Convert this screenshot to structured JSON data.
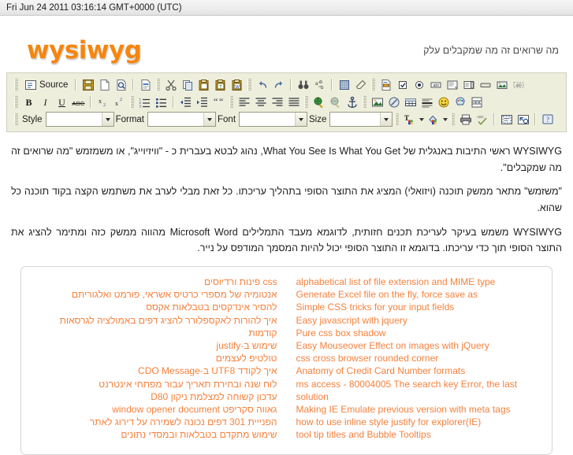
{
  "statusbar": {
    "datetime": "Fri Jun 24 2011 03:16:14 GMT+0000 (UTC)"
  },
  "header": {
    "logo": "wysiwyg",
    "tagline": "מה שרואים זה מה שמקבלים עלק"
  },
  "editor": {
    "toolbar_rows": [
      {
        "id": "row1",
        "items": [
          {
            "type": "grip",
            "name": "toolbar-grip"
          },
          {
            "type": "source",
            "name": "source-button",
            "label": "Source",
            "icon": "source-icon"
          },
          {
            "type": "sep"
          },
          {
            "type": "btn",
            "name": "save-button",
            "icon": "floppy-save-icon"
          },
          {
            "type": "btn",
            "name": "new-page-button",
            "icon": "new-page-icon"
          },
          {
            "type": "btn",
            "name": "preview-button",
            "icon": "preview-magnifier-icon"
          },
          {
            "type": "sep"
          },
          {
            "type": "btn",
            "name": "templates-button",
            "icon": "templates-icon"
          },
          {
            "type": "grip",
            "name": "toolbar-grip"
          },
          {
            "type": "btn",
            "name": "cut-button",
            "icon": "scissors-icon"
          },
          {
            "type": "btn",
            "name": "copy-button",
            "icon": "copy-icon"
          },
          {
            "type": "btn",
            "name": "paste-button",
            "icon": "paste-icon"
          },
          {
            "type": "btn",
            "name": "paste-text-button",
            "icon": "paste-text-icon"
          },
          {
            "type": "btn",
            "name": "paste-word-button",
            "icon": "paste-word-icon"
          },
          {
            "type": "grip",
            "name": "toolbar-grip"
          },
          {
            "type": "btn",
            "name": "undo-button",
            "icon": "undo-arrow-icon"
          },
          {
            "type": "btn",
            "name": "redo-button",
            "icon": "redo-arrow-icon"
          },
          {
            "type": "sep"
          },
          {
            "type": "btn",
            "name": "find-button",
            "icon": "binoculars-icon"
          },
          {
            "type": "btn",
            "name": "replace-button",
            "icon": "replace-icon"
          },
          {
            "type": "sep"
          },
          {
            "type": "btn",
            "name": "select-all-button",
            "icon": "select-all-icon"
          },
          {
            "type": "btn",
            "name": "remove-format-button",
            "icon": "eraser-icon"
          },
          {
            "type": "grip",
            "name": "toolbar-grip"
          },
          {
            "type": "btn",
            "name": "form-button",
            "icon": "form-icon"
          },
          {
            "type": "btn",
            "name": "checkbox-button",
            "icon": "checkbox-icon"
          },
          {
            "type": "btn",
            "name": "radio-button",
            "icon": "radio-icon"
          },
          {
            "type": "btn",
            "name": "text-field-button",
            "icon": "text-field-icon"
          },
          {
            "type": "btn",
            "name": "textarea-button",
            "icon": "textarea-icon"
          },
          {
            "type": "btn",
            "name": "select-field-button",
            "icon": "select-field-icon"
          },
          {
            "type": "btn",
            "name": "push-button-button",
            "icon": "push-button-icon"
          },
          {
            "type": "btn",
            "name": "image-button-button",
            "icon": "image-button-icon"
          },
          {
            "type": "btn",
            "name": "hidden-field-button",
            "icon": "hidden-field-icon"
          }
        ]
      },
      {
        "id": "row2",
        "items": [
          {
            "type": "grip",
            "name": "toolbar-grip"
          },
          {
            "type": "btn",
            "name": "bold-button",
            "icon": "bold-icon",
            "text": "B"
          },
          {
            "type": "btn",
            "name": "italic-button",
            "icon": "italic-icon",
            "text": "I"
          },
          {
            "type": "btn",
            "name": "underline-button",
            "icon": "underline-icon",
            "text": "U"
          },
          {
            "type": "btn",
            "name": "strikethrough-button",
            "icon": "strikethrough-icon",
            "text": "ABC"
          },
          {
            "type": "sep"
          },
          {
            "type": "btn",
            "name": "subscript-button",
            "icon": "subscript-icon"
          },
          {
            "type": "btn",
            "name": "superscript-button",
            "icon": "superscript-icon"
          },
          {
            "type": "grip",
            "name": "toolbar-grip"
          },
          {
            "type": "btn",
            "name": "numbered-list-button",
            "icon": "numbered-list-icon"
          },
          {
            "type": "btn",
            "name": "bulleted-list-button",
            "icon": "bulleted-list-icon"
          },
          {
            "type": "sep"
          },
          {
            "type": "btn",
            "name": "decrease-indent-button",
            "icon": "outdent-icon"
          },
          {
            "type": "btn",
            "name": "increase-indent-button",
            "icon": "indent-icon"
          },
          {
            "type": "btn",
            "name": "blockquote-button",
            "icon": "blockquote-icon"
          },
          {
            "type": "grip",
            "name": "toolbar-grip"
          },
          {
            "type": "btn",
            "name": "align-left-button",
            "icon": "align-left-icon"
          },
          {
            "type": "btn",
            "name": "align-center-button",
            "icon": "align-center-icon"
          },
          {
            "type": "btn",
            "name": "align-right-button",
            "icon": "align-right-icon"
          },
          {
            "type": "btn",
            "name": "align-justify-button",
            "icon": "align-justify-icon"
          },
          {
            "type": "grip",
            "name": "toolbar-grip"
          },
          {
            "type": "btn",
            "name": "link-button",
            "icon": "link-globe-icon"
          },
          {
            "type": "btn",
            "name": "unlink-button",
            "icon": "unlink-globe-icon"
          },
          {
            "type": "btn",
            "name": "anchor-button",
            "icon": "anchor-icon"
          },
          {
            "type": "grip",
            "name": "toolbar-grip"
          },
          {
            "type": "btn",
            "name": "image-button",
            "icon": "image-icon"
          },
          {
            "type": "btn",
            "name": "flash-button",
            "icon": "flash-icon"
          },
          {
            "type": "btn",
            "name": "table-button",
            "icon": "table-icon"
          },
          {
            "type": "btn",
            "name": "horizontal-rule-button",
            "icon": "horizontal-rule-icon"
          },
          {
            "type": "btn",
            "name": "smiley-button",
            "icon": "smiley-icon"
          },
          {
            "type": "btn",
            "name": "special-char-button",
            "icon": "omega-palette-icon"
          },
          {
            "type": "btn",
            "name": "page-break-button",
            "icon": "page-break-icon"
          }
        ]
      },
      {
        "id": "row3",
        "items": [
          {
            "type": "grip",
            "name": "toolbar-grip"
          },
          {
            "type": "combo",
            "name": "style-select",
            "label": "Style",
            "value": "",
            "width": "w-style"
          },
          {
            "type": "combo",
            "name": "format-select",
            "label": "Format",
            "value": "",
            "width": "w-format"
          },
          {
            "type": "combo",
            "name": "font-select",
            "label": "Font",
            "value": "",
            "width": "w-font"
          },
          {
            "type": "combo",
            "name": "size-select",
            "label": "Size",
            "value": "",
            "width": "w-size"
          },
          {
            "type": "grip",
            "name": "toolbar-grip"
          },
          {
            "type": "btnarrow",
            "name": "text-color-button",
            "icon": "text-color-icon"
          },
          {
            "type": "btnarrow",
            "name": "background-color-button",
            "icon": "bg-color-icon"
          },
          {
            "type": "grip",
            "name": "toolbar-grip"
          },
          {
            "type": "btn",
            "name": "print-button",
            "icon": "printer-icon"
          },
          {
            "type": "btn",
            "name": "spellcheck-button",
            "icon": "spellcheck-icon"
          },
          {
            "type": "sep"
          },
          {
            "type": "btn",
            "name": "show-blocks-button",
            "icon": "show-blocks-icon"
          },
          {
            "type": "btn",
            "name": "maximize-button",
            "icon": "maximize-icon"
          },
          {
            "type": "sep"
          },
          {
            "type": "btn",
            "name": "about-button",
            "icon": "help-about-icon"
          }
        ]
      }
    ]
  },
  "content": {
    "paragraphs": [
      "WYSIWYG ראשי התיבות באנגלית של What You See Is What You Get, נהוג לבטא בעברית כ - \"וויזיוייג\", או משמזמש \"מה שרואים זה מה שמקבלים\".",
      "\"משזמש\" מתאר ממשק תוכנה (ויזואלי) המציג את התוצר הסופי בתהליך עריכתו. כל זאת מבלי לערב את משתמש הקצה בקוד תוכנה כל שהוא.",
      "WYSIWYG משמש בעיקר לעריכת תכנים חזותית, לדוגמא מעבד התמלילים Microsoft Word מהווה ממשק כזה ומתימר להציג את התוצר הסופי תוך כדי עריכתו. בדוגמא זו התוצר הסופי יכול להיות המסמך המודפס על נייר."
    ]
  },
  "links_panel": {
    "left_column": [
      "alphabetical list of file extension and MIME type",
      "Generate Excel file on the fly, force save as",
      "Simple CSS tricks for your input fields",
      "Easy javascript with jquery",
      "Pure css box shadow",
      "Easy Mouseover Effect on images with jQuery",
      "css cross browser rounded corner",
      "Anatomy of Credit Card Number formats",
      "ms access - 80004005 The search key Error, the last solution",
      "Making IE Emulate previous version with meta tags",
      "how to use inline style justify for explorer(IE)",
      "tool tip titles and Bubble Tooltips"
    ],
    "right_column": [
      "css פינות ורדיוסים",
      "אנטומיה של מספרי כרטיס אשראי, פורמט ואלגוריתם",
      "להסיר אינדקסים בטבלאות אקסס",
      "איך להורות לאקספלורר להציג דפים באמולציה לגרסאות קודמות",
      "שימוש ב-justify",
      "טולטיפ לעצמים",
      "איך לקודד UTF8 ב-CDO Message",
      "לוח שנה ובחירת תאריך עבור מפתחי אינטרנט",
      "עדכון קשוחה למצלמת ניקון D80",
      "גאווה סקריפט window opener document",
      "הפנייית 301 דפים נכונה לשמירה על דירוג לאתר",
      "שימוש מתקדם בטבלאות ובמסדי נתונים"
    ]
  },
  "colors": {
    "accent_orange": "#f5860f",
    "link_orange": "#f5813c",
    "toolbar_bg": "#eeeedc"
  }
}
